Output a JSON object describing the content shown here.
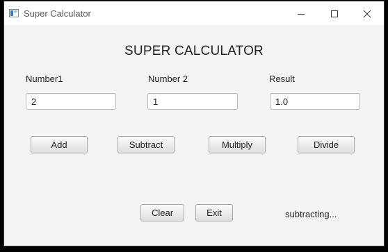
{
  "window": {
    "title": "Super Calculator",
    "icon": "app-window-icon",
    "controls": [
      "minimize-icon",
      "maximize-icon",
      "close-icon"
    ]
  },
  "heading": "SUPER CALCULATOR",
  "fields": {
    "number1": {
      "label": "Number1",
      "value": "2"
    },
    "number2": {
      "label": "Number 2",
      "value": "1"
    },
    "result": {
      "label": "Result",
      "value": "1.0"
    }
  },
  "operations": {
    "add": "Add",
    "subtract": "Subtract",
    "multiply": "Multiply",
    "divide": "Divide"
  },
  "actions": {
    "clear": "Clear",
    "exit": "Exit"
  },
  "status": "subtracting..."
}
